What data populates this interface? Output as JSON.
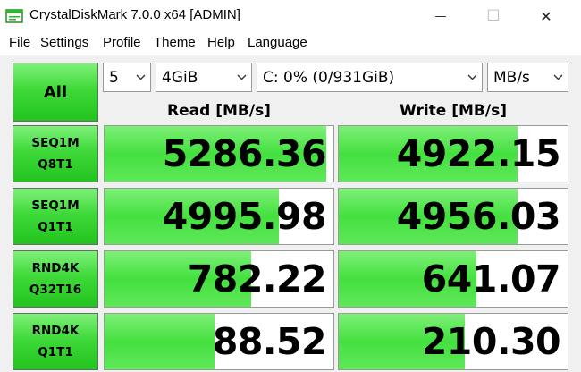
{
  "window": {
    "title": "CrystalDiskMark 7.0.0 x64 [ADMIN]",
    "minimize_glyph": "—",
    "maximize_glyph": "☐",
    "close_glyph": "✕"
  },
  "menu": [
    "File",
    "Settings",
    "Profile",
    "Theme",
    "Help",
    "Language"
  ],
  "controls": {
    "all_label": "All",
    "count": "5",
    "size": "4GiB",
    "drive": "C: 0% (0/931GiB)",
    "unit": "MB/s"
  },
  "headers": {
    "read": "Read [MB/s]",
    "write": "Write [MB/s]"
  },
  "rows": [
    {
      "line1": "SEQ1M",
      "line2": "Q8T1",
      "read": "5286.36",
      "write": "4922.15"
    },
    {
      "line1": "SEQ1M",
      "line2": "Q1T1",
      "read": "4995.98",
      "write": "4956.03"
    },
    {
      "line1": "RND4K",
      "line2": "Q32T16",
      "read": "782.22",
      "write": "641.07"
    },
    {
      "line1": "RND4K",
      "line2": "Q1T1",
      "read": "88.52",
      "write": "210.30"
    }
  ],
  "bar_fill": [
    {
      "read": 0.97,
      "write": 0.78
    },
    {
      "read": 0.76,
      "write": 0.78
    },
    {
      "read": 0.64,
      "write": 0.6
    },
    {
      "read": 0.48,
      "write": 0.55
    }
  ],
  "colors": {
    "accent_green": "#3fd93a",
    "bar_green": "#44e03f"
  }
}
